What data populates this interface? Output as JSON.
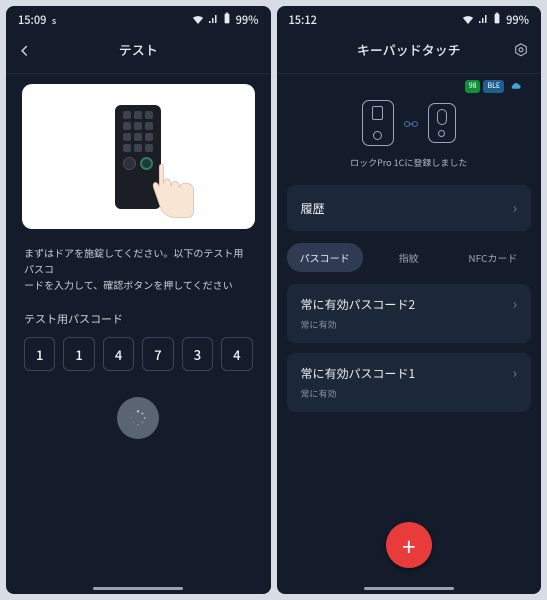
{
  "left": {
    "status": {
      "time": "15:09",
      "mode": "s",
      "battery": "99%"
    },
    "header": {
      "title": "テスト"
    },
    "instructions_line1": "まずはドアを施錠してください。以下のテスト用パスコ",
    "instructions_line2": "ードを入力して、確認ボタンを押してください",
    "section_label": "テスト用パスコード",
    "passcode": [
      "1",
      "1",
      "4",
      "7",
      "3",
      "4"
    ]
  },
  "right": {
    "status": {
      "time": "15:12",
      "battery": "99%"
    },
    "header": {
      "title": "キーパッドタッチ"
    },
    "device": {
      "registered_text": "ロックPro 1Cに登録しました",
      "badges": {
        "batt": "98",
        "ble": "BLE"
      }
    },
    "history_label": "履歴",
    "tabs": {
      "passcode": "パスコード",
      "fingerprint": "指紋",
      "nfc": "NFCカード"
    },
    "items": [
      {
        "title": "常に有効パスコード2",
        "subtitle": "常に有効"
      },
      {
        "title": "常に有効パスコード1",
        "subtitle": "常に有効"
      }
    ],
    "fab_label": "+"
  }
}
